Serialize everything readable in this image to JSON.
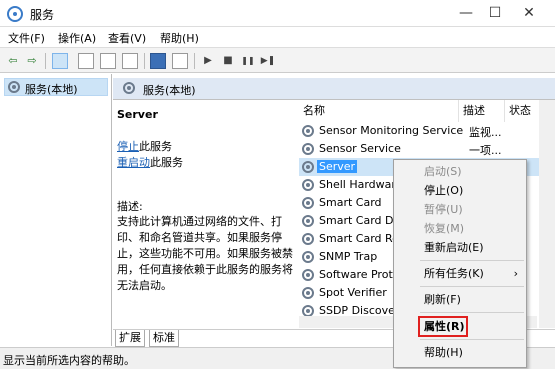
{
  "window": {
    "title": "服务",
    "minimize": "—",
    "maximize": "☐",
    "close": "✕"
  },
  "menu": [
    "文件(F)",
    "操作(A)",
    "查看(V)",
    "帮助(H)"
  ],
  "toolbar": {
    "back": "⇦",
    "forward": "⇨",
    "play": "▶",
    "stop": "■",
    "pause": "❚❚",
    "restart": "▶❚"
  },
  "tree": {
    "root": "服务(本地)"
  },
  "panel": {
    "title": "服务(本地)"
  },
  "details": {
    "service_name": "Server",
    "stop_link": "停止",
    "stop_suffix": "此服务",
    "restart_link": "重启动",
    "restart_suffix": "此服务",
    "desc_label": "描述:",
    "desc_lines": [
      "支持此计算机通过网络的文件、打",
      "印、和命名管道共享。如果服务停",
      "止，这些功能不可用。如果服务被禁",
      "用，任何直接依赖于此服务的服务将",
      "无法启动。"
    ]
  },
  "columns": {
    "name": "名称",
    "desc": "描述",
    "status": "状态"
  },
  "services": [
    {
      "name": "Sensor Monitoring Service",
      "desc": "监视..."
    },
    {
      "name": "Sensor Service",
      "desc": "一项..."
    },
    {
      "name": "Server",
      "desc": ""
    },
    {
      "name": "Shell Hardware Detection",
      "desc": ""
    },
    {
      "name": "Smart Card",
      "desc": ""
    },
    {
      "name": "Smart Card Device Enumeration",
      "desc": ""
    },
    {
      "name": "Smart Card Removal Policy",
      "desc": ""
    },
    {
      "name": "SNMP Trap",
      "desc": ""
    },
    {
      "name": "Software Protection",
      "desc": ""
    },
    {
      "name": "Spot Verifier",
      "desc": ""
    },
    {
      "name": "SSDP Discovery",
      "desc": ""
    }
  ],
  "context_menu": {
    "start": "启动(S)",
    "stop": "停止(O)",
    "pause": "暂停(U)",
    "resume": "恢复(M)",
    "restart": "重新启动(E)",
    "all_tasks": "所有任务(K)",
    "refresh": "刷新(F)",
    "properties": "属性(R)",
    "help": "帮助(H)"
  },
  "tabs": [
    "扩展",
    "标准"
  ],
  "status": "显示当前所选内容的帮助。",
  "colors": {
    "selection": "#cde4f7",
    "highlight": "#3399ff",
    "marker": "#e0201f",
    "link": "#1a5fb4"
  }
}
